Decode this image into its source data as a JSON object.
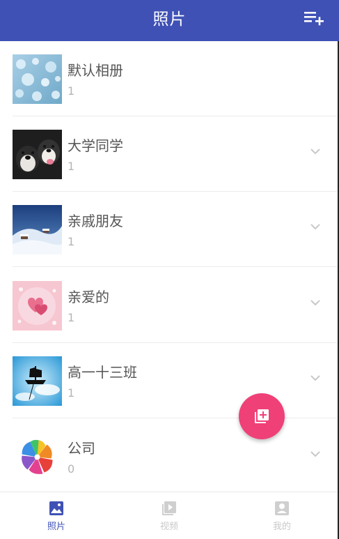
{
  "header": {
    "title": "照片",
    "action_icon": "add-to-list-icon",
    "background": "#3f51b5"
  },
  "albums": [
    {
      "name": "默认相册",
      "count": "1",
      "thumb": "bubbles-photo",
      "expandable": false
    },
    {
      "name": "大学同学",
      "count": "1",
      "thumb": "dogs-photo",
      "expandable": true
    },
    {
      "name": "亲戚朋友",
      "count": "1",
      "thumb": "snow-landscape-photo",
      "expandable": true
    },
    {
      "name": "亲爱的",
      "count": "1",
      "thumb": "pink-hearts-photo",
      "expandable": true
    },
    {
      "name": "高一十三班",
      "count": "1",
      "thumb": "pirate-ship-sky-photo",
      "expandable": true
    },
    {
      "name": "公司",
      "count": "0",
      "thumb": "pinwheel-logo",
      "expandable": true
    }
  ],
  "fab": {
    "icon": "add-photo-library-icon",
    "color": "#ef4078"
  },
  "bottom_nav": [
    {
      "label": "照片",
      "icon": "photo-icon",
      "active": true
    },
    {
      "label": "视频",
      "icon": "video-icon",
      "active": false
    },
    {
      "label": "我的",
      "icon": "account-icon",
      "active": false
    }
  ],
  "colors": {
    "primary": "#3f51b5",
    "accent": "#ef4078",
    "text": "#555555",
    "subtext": "#b5b5b5"
  }
}
